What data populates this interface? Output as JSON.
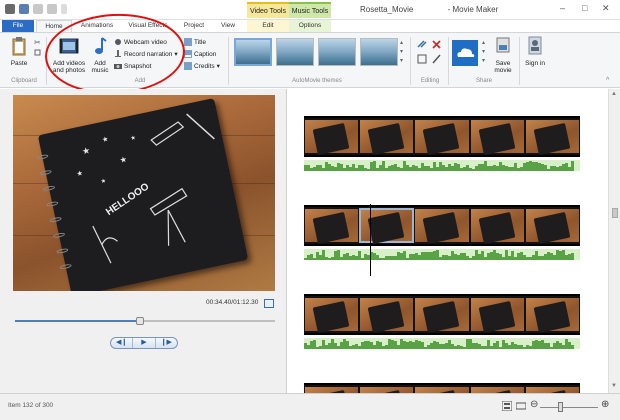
{
  "window": {
    "title": "Rosetta_Movie",
    "app_name": "- Movie Maker",
    "contextual_tabs": {
      "video_tools": "Video Tools",
      "music_tools": "Music Tools"
    }
  },
  "tabs": [
    {
      "label": "File"
    },
    {
      "label": "Home"
    },
    {
      "label": "Animations"
    },
    {
      "label": "Visual Effects"
    },
    {
      "label": "Project"
    },
    {
      "label": "View"
    },
    {
      "label": "Edit"
    },
    {
      "label": "Options"
    }
  ],
  "ribbon": {
    "clipboard": {
      "label": "Clipboard",
      "paste": "Paste"
    },
    "add": {
      "label": "Add",
      "add_videos": "Add videos and photos",
      "add_music": "Add music",
      "webcam": "Webcam video",
      "record_narration": "Record narration",
      "snapshot": "Snapshot",
      "title": "Title",
      "caption": "Caption",
      "credits": "Credits"
    },
    "themes": {
      "label": "AutoMovie themes"
    },
    "editing": {
      "label": "Editing"
    },
    "share": {
      "label": "Share",
      "save_movie": "Save movie"
    },
    "signin": "Sign in"
  },
  "preview": {
    "timecode": "00:34.40/01:12.30",
    "progress_fraction": 0.48
  },
  "status": {
    "item_text": "Item 132 of 300"
  },
  "colors": {
    "accent": "#2b6cc4",
    "annotation": "#dd1111",
    "audio": "#5aa246"
  }
}
